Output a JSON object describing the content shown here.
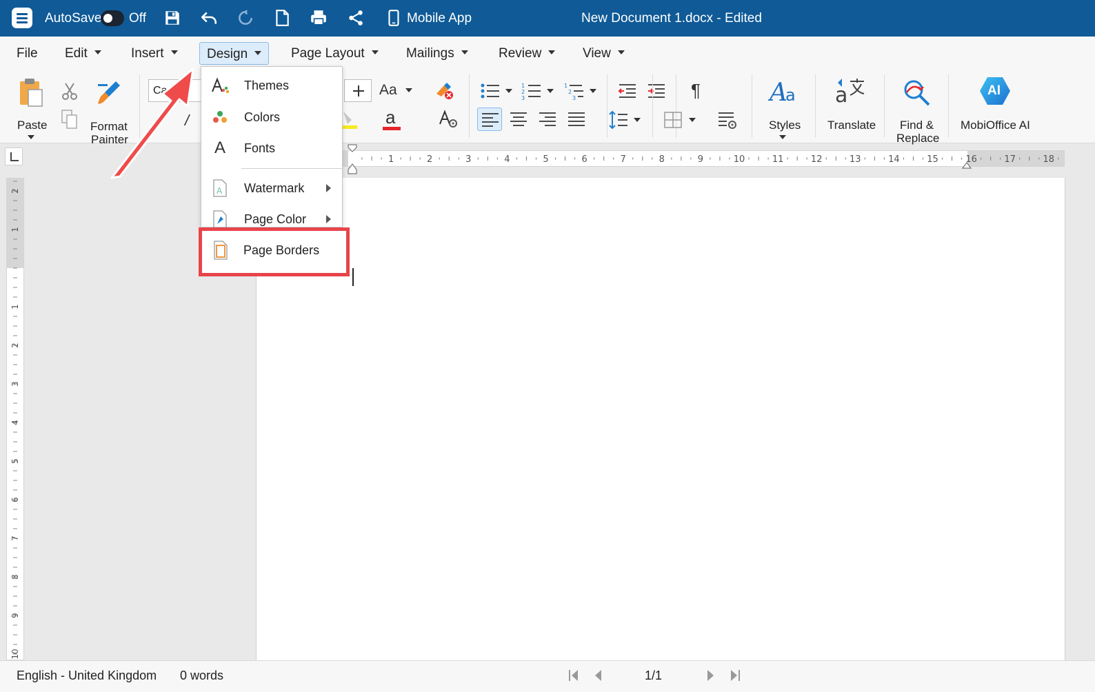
{
  "titlebar": {
    "autosave_label": "AutoSave",
    "autosave_state": "Off",
    "mobile_app_label": "Mobile App",
    "document_title": "New Document 1.docx - Edited",
    "bg_color": "#0f5a97"
  },
  "menubar": {
    "items": [
      {
        "label": "File"
      },
      {
        "label": "Edit"
      },
      {
        "label": "Insert"
      },
      {
        "label": "Design"
      },
      {
        "label": "Page Layout"
      },
      {
        "label": "Mailings"
      },
      {
        "label": "Review"
      },
      {
        "label": "View"
      }
    ],
    "active": "Design"
  },
  "ribbon": {
    "paste_label": "Paste",
    "format_painter_label_1": "Format",
    "format_painter_label_2": "Painter",
    "font_name": "Ca",
    "font_size_glyph": "Aa",
    "font_color_glyph": "a",
    "italic_glyph": "/",
    "pilcrow_glyph": "¶",
    "styles_label": "Styles",
    "translate_label": "Translate",
    "find_label_1": "Find &",
    "find_label_2": "Replace",
    "ai_label": "MobiOffice AI",
    "ai_badge": "AI"
  },
  "design_menu": {
    "items": [
      {
        "label": "Themes",
        "icon": "themes-icon"
      },
      {
        "label": "Colors",
        "icon": "colors-icon"
      },
      {
        "label": "Fonts",
        "icon": "fonts-icon"
      },
      {
        "label": "Watermark",
        "icon": "watermark-icon"
      },
      {
        "label": "Page Color",
        "icon": "page-color-icon"
      },
      {
        "label": "Page Borders",
        "icon": "page-borders-icon"
      }
    ],
    "fonts_glyph": "A",
    "watermark_glyph": "A"
  },
  "ruler": {
    "h_numbers": [
      "1",
      "2",
      "3",
      "4",
      "5",
      "6",
      "7",
      "8",
      "9",
      "10",
      "11",
      "12",
      "13",
      "14",
      "15",
      "16",
      "17",
      "18"
    ],
    "v_numbers": [
      "2",
      "1",
      "1",
      "2",
      "3",
      "4",
      "5",
      "6",
      "7",
      "8",
      "9",
      "10"
    ]
  },
  "statusbar": {
    "language": "English - United Kingdom",
    "word_count": "0 words",
    "page_indicator": "1/1"
  },
  "colors": {
    "accent": "#0f5a97",
    "highlight_box": "#e8444a",
    "active_bg": "#dcecfb"
  }
}
